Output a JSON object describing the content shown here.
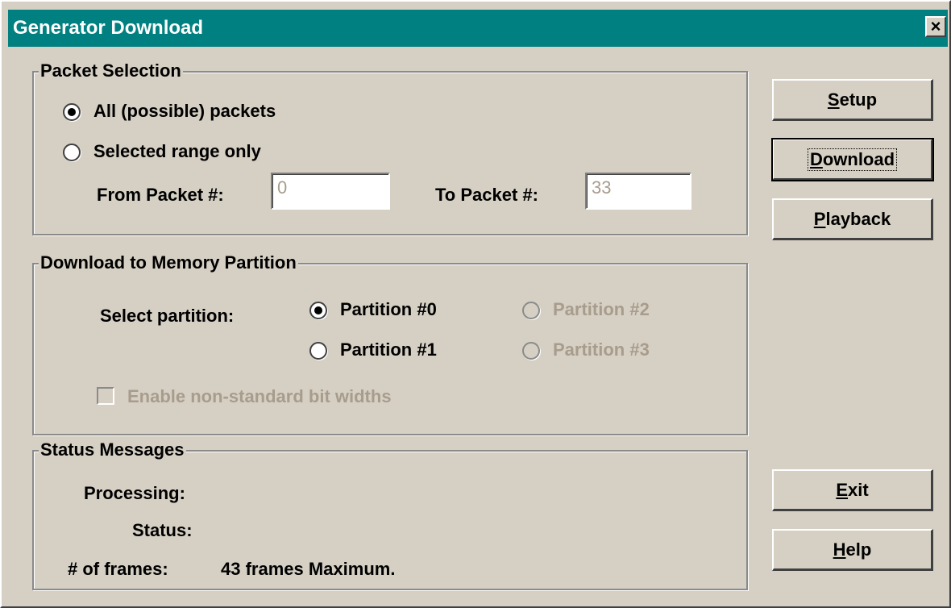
{
  "window": {
    "title": "Generator Download",
    "close_symbol": "×"
  },
  "packet_selection": {
    "label": "Packet Selection",
    "all_packets": "All (possible) packets",
    "selected_range": "Selected range only",
    "from_label": "From Packet #:",
    "from_value": "0",
    "to_label": "To Packet #:",
    "to_value": "33"
  },
  "download_partition": {
    "label": "Download to Memory Partition",
    "select_label": "Select partition:",
    "partition0": "Partition #0",
    "partition1": "Partition #1",
    "partition2": "Partition #2",
    "partition3": "Partition #3",
    "nonstandard": "Enable non-standard bit widths"
  },
  "status": {
    "label": "Status Messages",
    "processing_label": "Processing:",
    "status_label": "Status:",
    "frames_label": "# of frames:",
    "frames_value": "43 frames Maximum."
  },
  "buttons": {
    "setup": {
      "mnemonic": "S",
      "rest": "etup"
    },
    "download": {
      "mnemonic": "D",
      "rest": "ownload"
    },
    "playback": {
      "mnemonic": "P",
      "rest": "layback"
    },
    "exit": {
      "mnemonic": "E",
      "rest": "xit"
    },
    "help": {
      "mnemonic": "H",
      "rest": "elp"
    }
  }
}
